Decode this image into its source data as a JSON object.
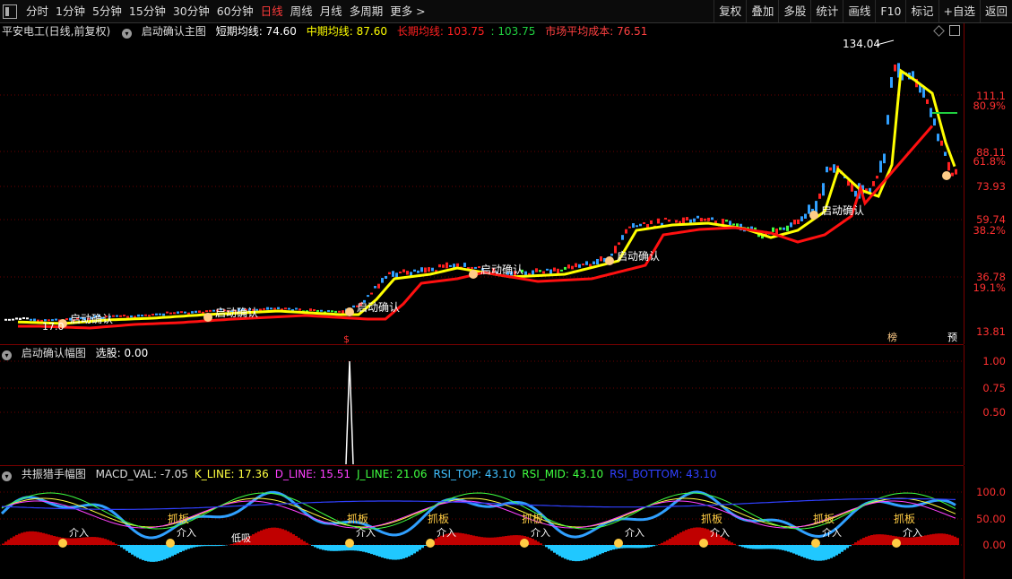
{
  "toolbar": {
    "periods": [
      "分时",
      "1分钟",
      "5分钟",
      "15分钟",
      "30分钟",
      "60分钟",
      "日线",
      "周线",
      "月线",
      "多周期",
      "更多 >"
    ],
    "active_period": "日线",
    "right_buttons": [
      "复权",
      "叠加",
      "多股",
      "统计",
      "画线",
      "F10",
      "标记",
      "+自选",
      "返回"
    ]
  },
  "main_panel": {
    "stock_title": "平安电工(日线,前复权)",
    "indicator_name": "启动确认主图",
    "ma_short": {
      "label": "短期均线:",
      "value": "74.60",
      "color": "#ffffff"
    },
    "ma_mid": {
      "label": "中期均线:",
      "value": "87.60",
      "color": "#ffff00"
    },
    "ma_long": {
      "label": "长期均线:",
      "value": "103.75",
      "color": "#ff2020"
    },
    "ma_long_extra": {
      "value": ": 103.75",
      "color": "#20d040"
    },
    "cost": {
      "label": "市场平均成本:",
      "value": "76.51",
      "color": "#ff4040"
    },
    "high_price": "134.04",
    "signal_text": "启动确认",
    "price_labels": [
      "111.1",
      "88.11",
      "73.93",
      "59.74",
      "36.78",
      "13.81"
    ],
    "pct_labels": [
      "80.9%",
      "61.8%",
      "38.2%",
      "19.1%"
    ],
    "low_price_marker": "17.0",
    "bottom_tags": [
      "榜",
      "预"
    ]
  },
  "mid_panel": {
    "title": "启动确认幅图",
    "value_text": "选股: 0.00",
    "axis_labels": [
      "1.00",
      "0.75",
      "0.50"
    ]
  },
  "bottom_panel": {
    "title": "共振猎手幅图",
    "items": [
      {
        "text": "MACD_VAL: -7.05",
        "color": "#dddddd"
      },
      {
        "text": "K_LINE: 17.36",
        "color": "#ffff40"
      },
      {
        "text": "D_LINE: 15.51",
        "color": "#ff40ff"
      },
      {
        "text": "J_LINE: 21.06",
        "color": "#40ff40"
      },
      {
        "text": "RSI_TOP: 43.10",
        "color": "#40c0ff"
      },
      {
        "text": "RSI_MID: 43.10",
        "color": "#40ff40"
      },
      {
        "text": "RSI_BOTTOM: 43.10",
        "color": "#3040ff"
      }
    ],
    "axis_labels": [
      "100.0",
      "50.00",
      "0.00"
    ],
    "tag_catch": "抓板",
    "tag_buy": "介入",
    "tag_low": "低吸"
  },
  "colors": {
    "up": "#ff2020",
    "down": "#30a0ff",
    "grid": "#7a0000",
    "ma_yellow": "#ffff00",
    "ma_red": "#ff1010"
  }
}
